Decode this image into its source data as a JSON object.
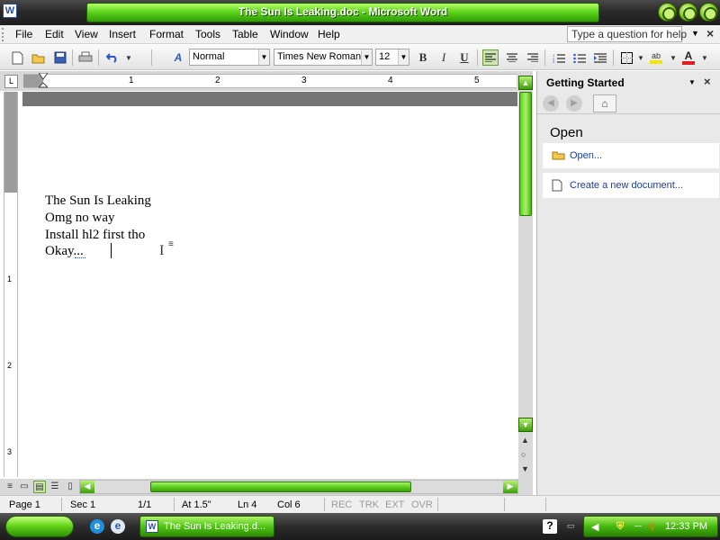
{
  "window": {
    "title": "The Sun Is Leaking.doc - Microsoft Word",
    "app_icon_letter": "W"
  },
  "menu": {
    "items": [
      "File",
      "Edit",
      "View",
      "Insert",
      "Format",
      "Tools",
      "Table",
      "Window",
      "Help"
    ],
    "help_placeholder": "Type a question for help"
  },
  "toolbar": {
    "style": "Normal",
    "font": "Times New Roman",
    "size": "12",
    "bold_label": "B",
    "italic_label": "I",
    "underline_label": "U"
  },
  "ruler": {
    "numbers": [
      "1",
      "2",
      "3",
      "4",
      "5"
    ],
    "vertical_numbers": [
      "1",
      "2",
      "3"
    ],
    "tab_selector": "L"
  },
  "document": {
    "lines": [
      "The Sun Is Leaking",
      "Omg no way",
      "Install hl2 first tho",
      "Okay..."
    ]
  },
  "taskpane": {
    "title": "Getting Started",
    "section": "Open",
    "links": [
      "Open...",
      "Create a new document..."
    ]
  },
  "status": {
    "page": "Page 1",
    "sec": "Sec 1",
    "pages": "1/1",
    "at": "At 1.5\"",
    "ln": "Ln 4",
    "col": "Col 6",
    "rec": "REC",
    "trk": "TRK",
    "ext": "EXT",
    "ovr": "OVR"
  },
  "taskbar": {
    "task_label": "The Sun Is Leaking.d...",
    "clock": "12:33 PM",
    "help_glyph": "?"
  },
  "colors": {
    "accent_green": "#5fd61e",
    "link_blue": "#1b3f9a"
  }
}
